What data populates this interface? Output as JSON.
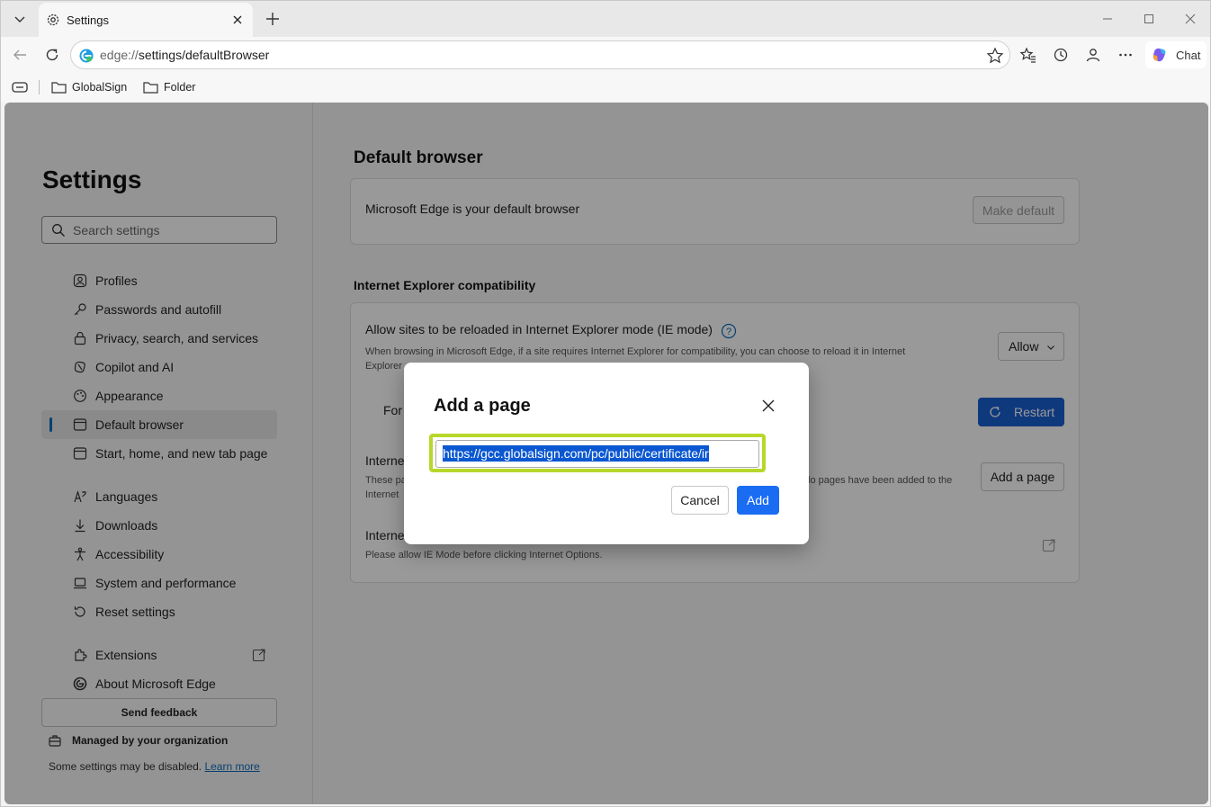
{
  "window": {
    "tab_title": "Settings",
    "address_proto": "edge://",
    "address_path": "settings/defaultBrowser",
    "chat_label": "Chat"
  },
  "favorites": [
    {
      "label": "GlobalSign",
      "icon": "folder-icon"
    },
    {
      "label": "Folder",
      "icon": "folder-icon"
    }
  ],
  "sidebar": {
    "title": "Settings",
    "search_placeholder": "Search settings",
    "items": [
      {
        "label": "Profiles",
        "icon": "profile-icon"
      },
      {
        "label": "Passwords and autofill",
        "icon": "key-icon"
      },
      {
        "label": "Privacy, search, and services",
        "icon": "lock-icon"
      },
      {
        "label": "Copilot and AI",
        "icon": "copilot-icon"
      },
      {
        "label": "Appearance",
        "icon": "appearance-icon"
      },
      {
        "label": "Default browser",
        "icon": "browser-icon",
        "active": true
      },
      {
        "label": "Start, home, and new tab page",
        "icon": "home-icon"
      },
      {
        "label": "Languages",
        "icon": "languages-icon"
      },
      {
        "label": "Downloads",
        "icon": "download-icon"
      },
      {
        "label": "Accessibility",
        "icon": "accessibility-icon"
      },
      {
        "label": "System and performance",
        "icon": "laptop-icon"
      },
      {
        "label": "Reset settings",
        "icon": "reset-icon"
      },
      {
        "label": "Extensions",
        "icon": "extensions-icon"
      },
      {
        "label": "About Microsoft Edge",
        "icon": "edge-logo-icon"
      }
    ],
    "feedback_label": "Send feedback",
    "managed_label": "Managed by your organization",
    "managed_note": "Some settings may be disabled.",
    "learn_more": "Learn more"
  },
  "main": {
    "heading": "Default browser",
    "default_text": "Microsoft Edge is your default browser",
    "make_default": "Make default",
    "ie_heading": "Internet Explorer compatibility",
    "allow_title": "Allow sites to be reloaded in Internet Explorer mode (IE mode)",
    "allow_desc_1": "When browsing in Microsoft Edge, if a site requires Internet Explorer for compatibility, you can choose to reload it in Internet",
    "allow_desc_2": "Explorer",
    "allow_value": "Allow",
    "for_label": "For",
    "restart_label": "Restart",
    "pages_title": "Interne",
    "pages_desc_1": "These pa",
    "pages_desc_2": "Internet",
    "pages_desc_right": "lo pages have been added to the",
    "add_page_label": "Add a page",
    "options_title": "Interne",
    "options_desc": "Please allow IE Mode before clicking Internet Options."
  },
  "dialog": {
    "title": "Add a page",
    "url_value": "https://gcc.globalsign.com/pc/public/certificate/ir",
    "cancel_label": "Cancel",
    "add_label": "Add"
  }
}
